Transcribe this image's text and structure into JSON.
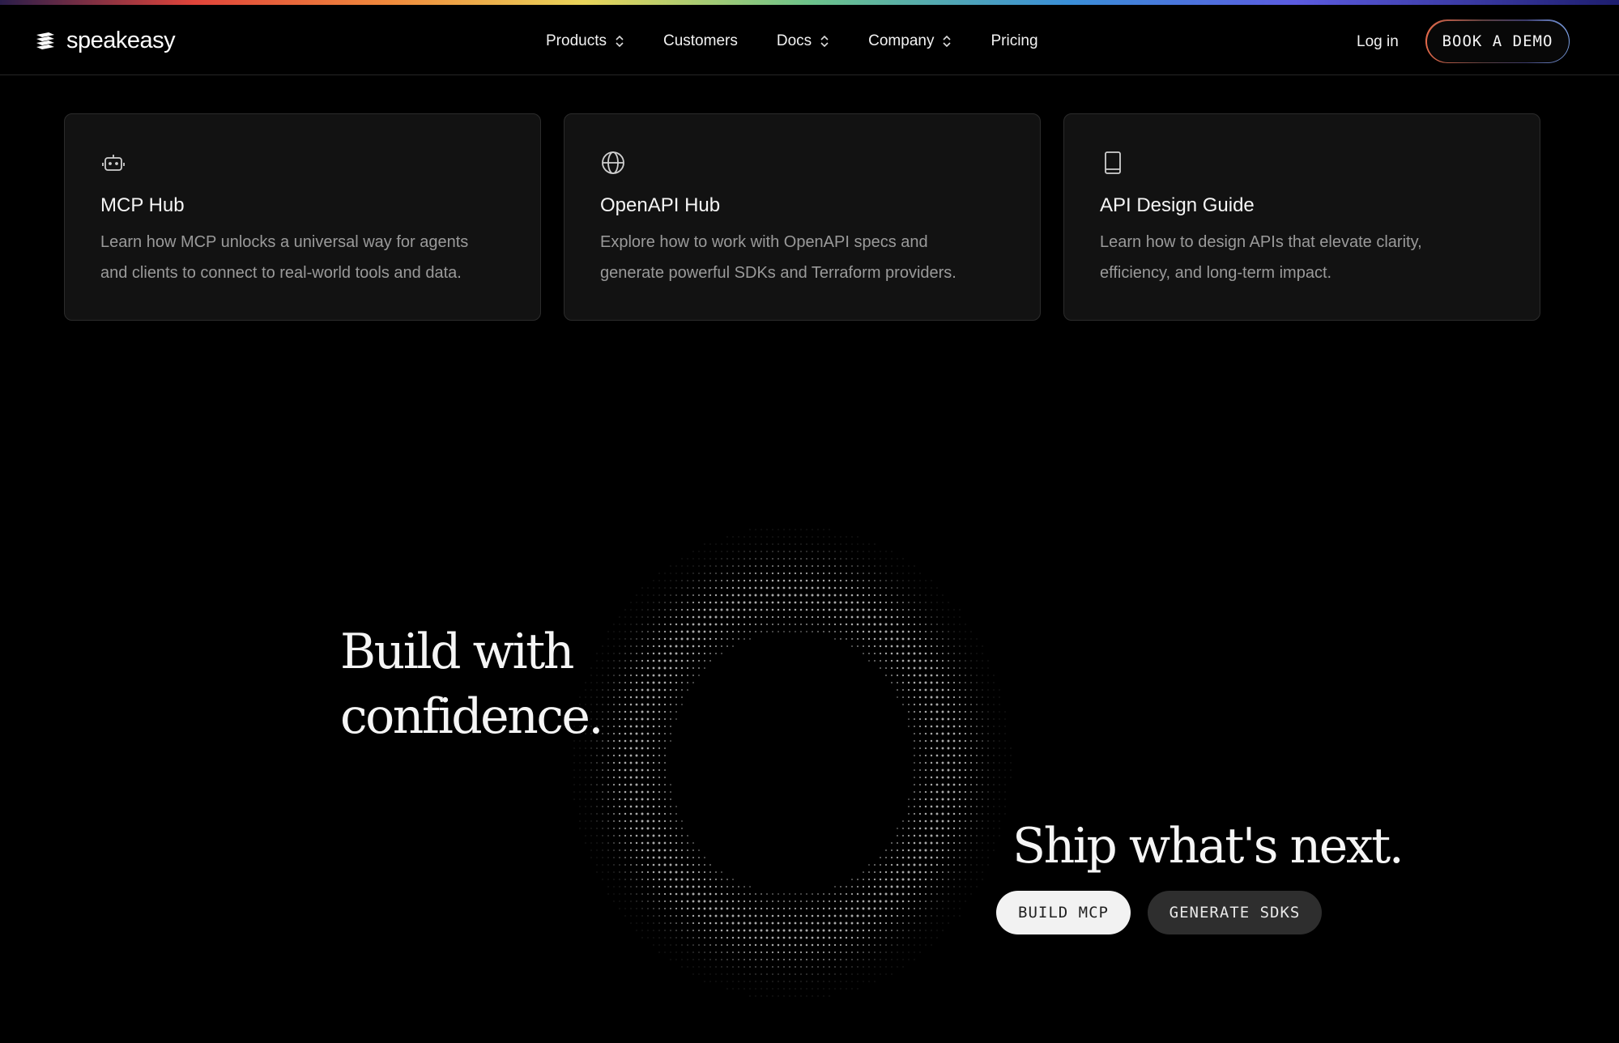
{
  "brand": {
    "name": "speakeasy"
  },
  "nav": {
    "items": [
      {
        "label": "Products",
        "has_dropdown": true
      },
      {
        "label": "Customers",
        "has_dropdown": false
      },
      {
        "label": "Docs",
        "has_dropdown": true
      },
      {
        "label": "Company",
        "has_dropdown": true
      },
      {
        "label": "Pricing",
        "has_dropdown": false
      }
    ],
    "login_label": "Log in",
    "demo_label": "BOOK A DEMO"
  },
  "cards": [
    {
      "icon": "robot-icon",
      "title": "MCP Hub",
      "desc_line1": "Learn how MCP unlocks a universal way for agents",
      "desc_line2": "and clients to connect to real-world tools and data."
    },
    {
      "icon": "globe-icon",
      "title": "OpenAPI Hub",
      "desc_line1": "Explore how to work with OpenAPI specs and",
      "desc_line2": "generate powerful SDKs and Terraform providers."
    },
    {
      "icon": "book-icon",
      "title": "API Design Guide",
      "desc_line1": "Learn how to design APIs that elevate clarity,",
      "desc_line2": "efficiency, and long-term impact."
    }
  ],
  "hero": {
    "left_line1": "Build with",
    "left_line2": "confidence.",
    "right_text": "Ship what's next.",
    "primary_button": "BUILD MCP",
    "secondary_button": "GENERATE SDKS"
  },
  "colors": {
    "background": "#000000",
    "card_bg": "#121212",
    "muted_text": "#9a9a9a"
  }
}
